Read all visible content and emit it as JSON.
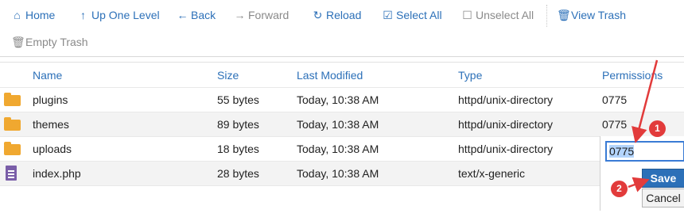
{
  "toolbar": {
    "home": "Home",
    "up": "Up One Level",
    "back": "Back",
    "forward": "Forward",
    "reload": "Reload",
    "select_all": "Select All",
    "unselect_all": "Unselect All",
    "view_trash": "View Trash",
    "empty_trash": "Empty Trash"
  },
  "table": {
    "columns": [
      "Name",
      "Size",
      "Last Modified",
      "Type",
      "Permissions"
    ],
    "rows": [
      {
        "name": "plugins",
        "size": "55 bytes",
        "modified": "Today, 10:38 AM",
        "type": "httpd/unix-directory",
        "perm": "0775",
        "kind": "folder"
      },
      {
        "name": "themes",
        "size": "89 bytes",
        "modified": "Today, 10:38 AM",
        "type": "httpd/unix-directory",
        "perm": "0775",
        "kind": "folder"
      },
      {
        "name": "uploads",
        "size": "18 bytes",
        "modified": "Today, 10:38 AM",
        "type": "httpd/unix-directory",
        "perm": "",
        "kind": "folder"
      },
      {
        "name": "index.php",
        "size": "28 bytes",
        "modified": "Today, 10:38 AM",
        "type": "text/x-generic",
        "perm": "",
        "kind": "file"
      }
    ]
  },
  "perm_editor": {
    "value": "0775",
    "save": "Save",
    "cancel": "Cancel"
  },
  "annotations": {
    "step1": "1",
    "step2": "2"
  },
  "colors": {
    "link": "#2c70b8",
    "folder": "#f0a830",
    "file": "#7a5ea8",
    "annotation": "#e23b3b",
    "save_button": "#2c70b8"
  }
}
